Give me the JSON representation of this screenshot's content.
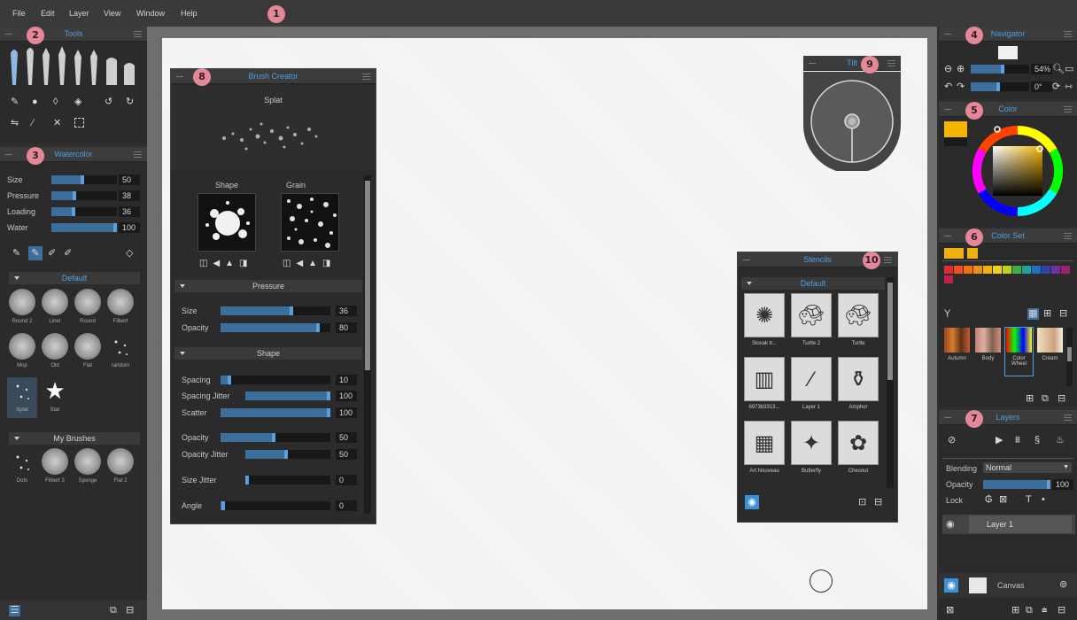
{
  "menu": [
    "File",
    "Edit",
    "Layer",
    "View",
    "Window",
    "Help"
  ],
  "badges": [
    "1",
    "2",
    "3",
    "4",
    "5",
    "6",
    "7",
    "8",
    "9",
    "10"
  ],
  "tools_panel": {
    "title": "Tools"
  },
  "watercolor_panel": {
    "title": "Watercolor",
    "sliders": [
      {
        "label": "Size",
        "value": "50",
        "fill": 0.5
      },
      {
        "label": "Pressure",
        "value": "38",
        "fill": 0.38
      },
      {
        "label": "Loading",
        "value": "36",
        "fill": 0.36
      },
      {
        "label": "Water",
        "value": "100",
        "fill": 1.0
      }
    ],
    "default_group": "Default",
    "brushes": [
      "Round 2",
      "Liner",
      "Round",
      "Filbert",
      "Mop",
      "Old",
      "Flat",
      "random",
      "Splat",
      "Star"
    ],
    "my_brushes_group": "My Brushes",
    "my_brushes": [
      "Dots",
      "Filbert 3",
      "Sponge",
      "Flat 2"
    ]
  },
  "brush_creator": {
    "title": "Brush Creator",
    "preview_label": "Splat",
    "shape_label": "Shape",
    "grain_label": "Grain",
    "pressure_section": "Pressure",
    "pressure_sliders": [
      {
        "label": "Size",
        "value": "36",
        "fill": 0.66
      },
      {
        "label": "Opacity",
        "value": "80",
        "fill": 0.9
      }
    ],
    "shape_section": "Shape",
    "shape_sliders": [
      {
        "label": "Spacing",
        "value": "10",
        "fill": 0.1
      },
      {
        "label": "Spacing Jitter",
        "value": "100",
        "fill": 1.0
      },
      {
        "label": "Scatter",
        "value": "100",
        "fill": 1.0
      },
      {
        "label": "Opacity",
        "value": "50",
        "fill": 0.5
      },
      {
        "label": "Opacity Jitter",
        "value": "50",
        "fill": 0.5
      },
      {
        "label": "Size Jitter",
        "value": "0",
        "fill": 0.0
      },
      {
        "label": "Angle",
        "value": "0",
        "fill": 0.0
      }
    ]
  },
  "tilt": {
    "title": "Tilt"
  },
  "stencils": {
    "title": "Stencils",
    "group": "Default",
    "items": [
      "Slovak tr...",
      "Turtle 2",
      "Turtle",
      "6973b3313...",
      "Layer 1",
      "Amphor",
      "Art Nouveau",
      "Butterfly",
      "Chesnut"
    ]
  },
  "navigator": {
    "title": "Navigator",
    "zoom": "54%",
    "rotation": "0°"
  },
  "color": {
    "title": "Color",
    "primary": "#f5b400",
    "secondary": "#1a1a1a"
  },
  "color_set": {
    "title": "Color Set",
    "top_swatches": [
      "#f0b010",
      "#f0b010"
    ],
    "swatches": [
      "#d83030",
      "#f05020",
      "#f07010",
      "#f09010",
      "#f0b010",
      "#f0d020",
      "#c0d020",
      "#40b040",
      "#20a0a0",
      "#2070c0",
      "#3040b0",
      "#7030a0",
      "#a02070",
      "#c02050"
    ],
    "sets": [
      "Autumn",
      "Body",
      "Color Wheel",
      "Cream"
    ]
  },
  "layers": {
    "title": "Layers",
    "blending_label": "Blending",
    "blending_value": "Normal",
    "opacity_label": "Opacity",
    "opacity_value": "100",
    "lock_label": "Lock",
    "layer_name": "Layer 1",
    "canvas_label": "Canvas"
  }
}
